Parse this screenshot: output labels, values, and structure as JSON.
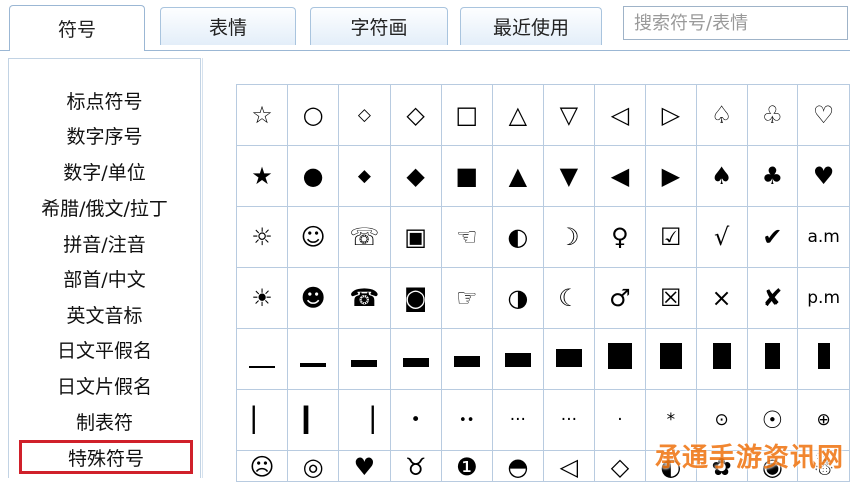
{
  "tabs": [
    {
      "label": "符号",
      "active": true
    },
    {
      "label": "表情",
      "active": false
    },
    {
      "label": "字符画",
      "active": false
    },
    {
      "label": "最近使用",
      "active": false
    }
  ],
  "search": {
    "placeholder": "搜索符号/表情"
  },
  "categories": [
    "标点符号",
    "数字序号",
    "数字/单位",
    "希腊/俄文/拉丁",
    "拼音/注音",
    "部首/中文",
    "英文音标",
    "日文平假名",
    "日文片假名",
    "制表符",
    "特殊符号"
  ],
  "selected_category": "特殊符号",
  "grid": {
    "row0": [
      "☆",
      "○",
      "◇",
      "◇",
      "□",
      "△",
      "▽",
      "◁",
      "▷",
      "♤",
      "♧",
      "♡"
    ],
    "row1": [
      "★",
      "●",
      "◆",
      "◆",
      "■",
      "▲",
      "▼",
      "◀",
      "▶",
      "♠",
      "♣",
      "♥"
    ],
    "row2": [
      "☼",
      "☺",
      "☏",
      "▣",
      "☜",
      "◐",
      "☽",
      "♀",
      "☑",
      "√",
      "✔",
      "a.m"
    ],
    "row3": [
      "☀",
      "☻",
      "☎",
      "◙",
      "☞",
      "◑",
      "☾",
      "♂",
      "☒",
      "×",
      "✘",
      "p.m"
    ],
    "row5": [
      "▏",
      "▎",
      "▕",
      "•",
      "••",
      "···",
      "···",
      "·",
      "*",
      "⊙",
      "☉",
      "⊕"
    ],
    "row6": [
      "☹",
      "◎",
      "♥",
      "♉",
      "❶",
      "◓",
      "◁",
      "◇",
      "◐",
      "✿",
      "◉",
      "☃"
    ]
  },
  "watermark": "承通手游资讯网",
  "colors": {
    "selected_border": "#d0202a",
    "tab_border": "#a9c4de",
    "grid_border": "#b8cbe0",
    "watermark": "#f07a1a"
  }
}
